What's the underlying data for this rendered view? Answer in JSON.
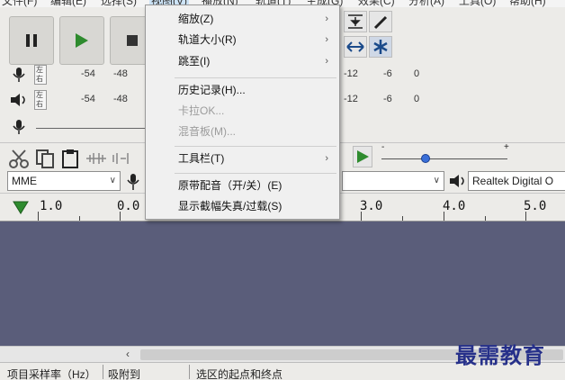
{
  "menubar": {
    "items": [
      "文件(F)",
      "编辑(E)",
      "选择(S)",
      "视图(V)",
      "播放(N)",
      "轨道(T)",
      "生成(G)",
      "效果(C)",
      "分析(A)",
      "工具(O)",
      "帮助(H)"
    ]
  },
  "meters": {
    "left_label": "左",
    "right_label": "右",
    "record_scale": [
      "-54",
      "-48"
    ],
    "record_scale_right": [
      "-12",
      "-6",
      "0"
    ],
    "play_scale": [
      "-54",
      "-48"
    ],
    "play_scale_right": [
      "-12",
      "-6",
      "0"
    ]
  },
  "device": {
    "host": "MME",
    "output_device": "Realtek Digital O"
  },
  "ruler": {
    "labels": [
      "1.0",
      "0.0",
      "3.0",
      "4.0",
      "5.0"
    ]
  },
  "view_menu": {
    "items": [
      {
        "label": "缩放(Z)",
        "submenu": true,
        "disabled": false
      },
      {
        "label": "轨道大小(R)",
        "submenu": true,
        "disabled": false
      },
      {
        "label": "跳至(I)",
        "submenu": true,
        "disabled": false
      },
      {
        "label": "历史记录(H)...",
        "submenu": false,
        "disabled": false
      },
      {
        "label": "卡拉OK...",
        "submenu": false,
        "disabled": true
      },
      {
        "label": "混音板(M)...",
        "submenu": false,
        "disabled": true
      },
      {
        "label": "工具栏(T)",
        "submenu": true,
        "disabled": false
      },
      {
        "label": "原带配音（开/关）(E)",
        "submenu": false,
        "disabled": false
      },
      {
        "label": "显示截幅失真/过载(S)",
        "submenu": false,
        "disabled": false
      }
    ],
    "submenu_glyph": "›"
  },
  "statusbar": {
    "rate_label": "项目采样率（Hz）",
    "snap_label": "吸附到",
    "selection_label": "选区的起点和终点"
  },
  "scroll": {
    "left_arrow": "‹"
  },
  "watermark": "最需教育",
  "colors": {
    "track_bg": "#5a5d7a",
    "play_green": "#2e8b2e",
    "tool_blue": "#1a4a8a",
    "menu_bg": "#f0f0f0"
  }
}
